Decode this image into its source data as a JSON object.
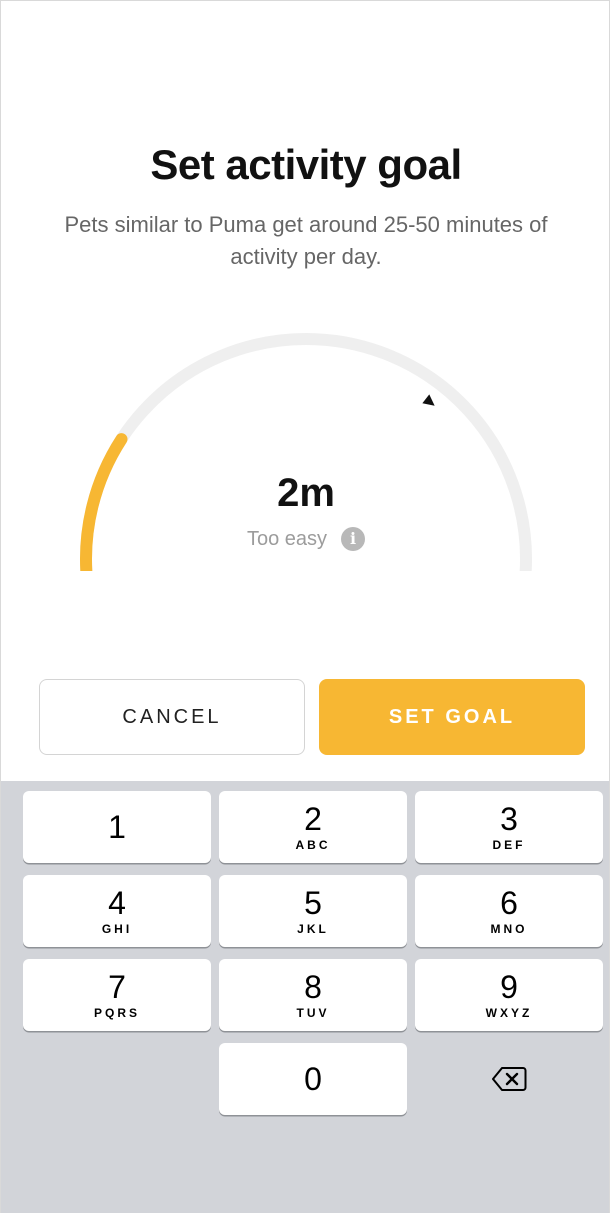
{
  "header": {
    "title": "Set activity goal",
    "subtitle": "Pets similar to Puma get around 25-50 minutes of activity per day."
  },
  "gauge": {
    "value_label": "2m",
    "status_label": "Too easy",
    "info_icon": "i",
    "progress_fraction": 0.2,
    "marker_fraction": 0.7,
    "colors": {
      "progress": "#F7B733",
      "track": "#EFEFEF",
      "marker": "#111111"
    }
  },
  "actions": {
    "cancel_label": "CANCEL",
    "set_goal_label": "SET GOAL"
  },
  "keypad": {
    "keys": [
      {
        "digit": "1",
        "letters": ""
      },
      {
        "digit": "2",
        "letters": "ABC"
      },
      {
        "digit": "3",
        "letters": "DEF"
      },
      {
        "digit": "4",
        "letters": "GHI"
      },
      {
        "digit": "5",
        "letters": "JKL"
      },
      {
        "digit": "6",
        "letters": "MNO"
      },
      {
        "digit": "7",
        "letters": "PQRS"
      },
      {
        "digit": "8",
        "letters": "TUV"
      },
      {
        "digit": "9",
        "letters": "WXYZ"
      },
      {
        "digit": "0",
        "letters": ""
      }
    ],
    "delete_icon": "backspace-icon"
  },
  "colors": {
    "accent": "#F7B733",
    "keyboard_bg": "#D2D4D9"
  }
}
